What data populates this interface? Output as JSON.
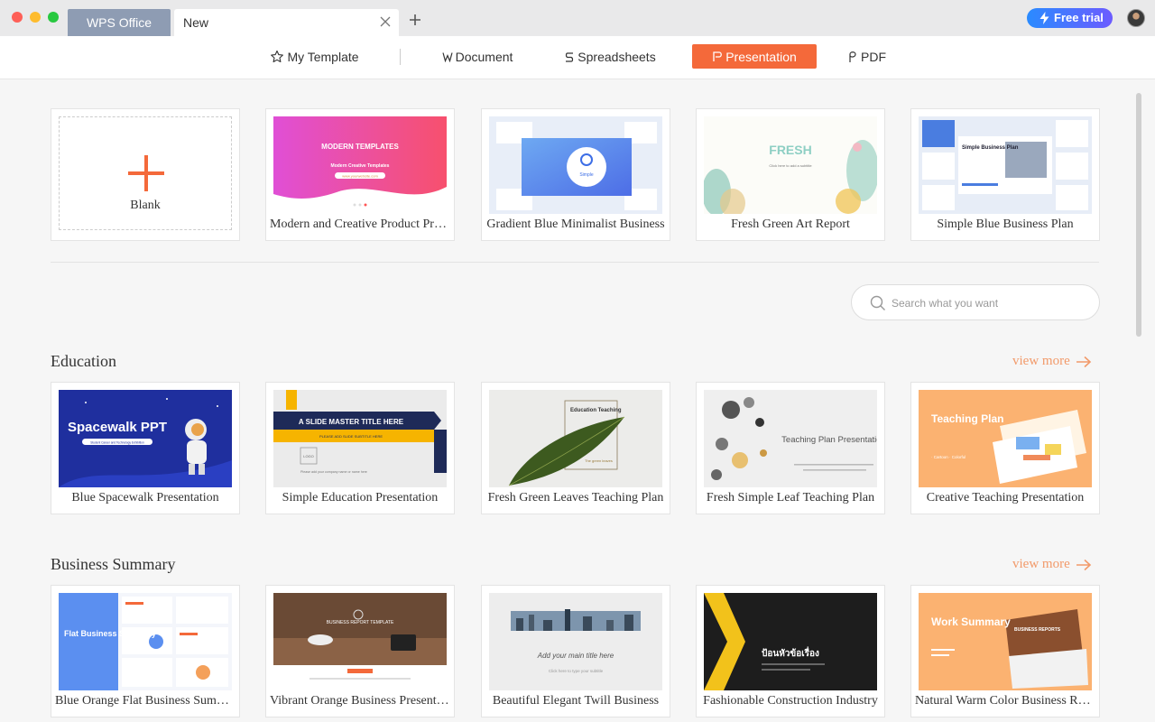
{
  "window": {
    "tabs": [
      {
        "label": "WPS Office"
      },
      {
        "label": "New"
      }
    ],
    "trial_label": "Free trial"
  },
  "nav": {
    "items": [
      {
        "label": "My Template",
        "icon": "star-icon"
      },
      {
        "label": "Document",
        "icon": "document-w-icon"
      },
      {
        "label": "Spreadsheets",
        "icon": "spreadsheet-s-icon"
      },
      {
        "label": "Presentation",
        "icon": "presentation-p-icon",
        "active": true
      },
      {
        "label": "PDF",
        "icon": "pdf-icon"
      }
    ]
  },
  "featured": {
    "blank_label": "Blank",
    "items": [
      {
        "title": "Modern and Creative Product Presentation",
        "thumb_title": "MODERN TEMPLATES",
        "thumb_sub": "Modern Creative Templates",
        "thumb_btn": "www.yourwebsite.com"
      },
      {
        "title": "Gradient Blue Minimalist Business",
        "thumb_title": "Simple"
      },
      {
        "title": "Fresh Green Art Report",
        "thumb_title": "FRESH",
        "thumb_sub": "Click here to add a subtitle"
      },
      {
        "title": "Simple Blue Business Plan",
        "thumb_title": "Simple Business Plan"
      }
    ]
  },
  "search": {
    "placeholder": "Search what you want"
  },
  "sections": [
    {
      "title": "Education",
      "view_more": "view more",
      "items": [
        {
          "title": "Blue Spacewalk Presentation",
          "thumb_title": "Spacewalk PPT",
          "thumb_sub": "Student Career and Technology Exhibition"
        },
        {
          "title": "Simple Education Presentation",
          "thumb_title": "A SLIDE MASTER TITLE HERE",
          "thumb_sub": "PLEASE ADD SLIDE SUBTITLE HERE",
          "thumb_logo": "LOGO",
          "thumb_note": "Please add your company name or name here"
        },
        {
          "title": "Fresh Green Leaves Teaching Plan",
          "thumb_title": "Education Teaching",
          "thumb_sub": "The green leaves"
        },
        {
          "title": "Fresh Simple Leaf Teaching Plan",
          "thumb_title": "Teaching Plan Presentation"
        },
        {
          "title": "Creative Teaching Presentation",
          "thumb_title": "Teaching Plan",
          "thumb_sub": "· Cartoon · Colorful"
        }
      ]
    },
    {
      "title": "Business Summary",
      "view_more": "view more",
      "items": [
        {
          "title": "Blue Orange Flat Business Summary",
          "thumb_title": "Flat Business Summary"
        },
        {
          "title": "Vibrant Orange Business Presentation",
          "thumb_title": "BUSINESS REPORT TEMPLATE"
        },
        {
          "title": "Beautiful Elegant Twill Business",
          "thumb_title": "Add your main title here",
          "thumb_sub": "Click here to type your subtitle"
        },
        {
          "title": "Fashionable Construction Industry",
          "thumb_title": "ป้อนหัวข้อเรื่อง"
        },
        {
          "title": "Natural Warm Color Business Report",
          "thumb_title": "Work Summary",
          "thumb_sub": "BUSINESS REPORTS"
        }
      ]
    }
  ],
  "colors": {
    "accent": "#f4693a",
    "view_more": "#f29a6a",
    "trial_start": "#2a8bff",
    "trial_end": "#6c5bff"
  }
}
